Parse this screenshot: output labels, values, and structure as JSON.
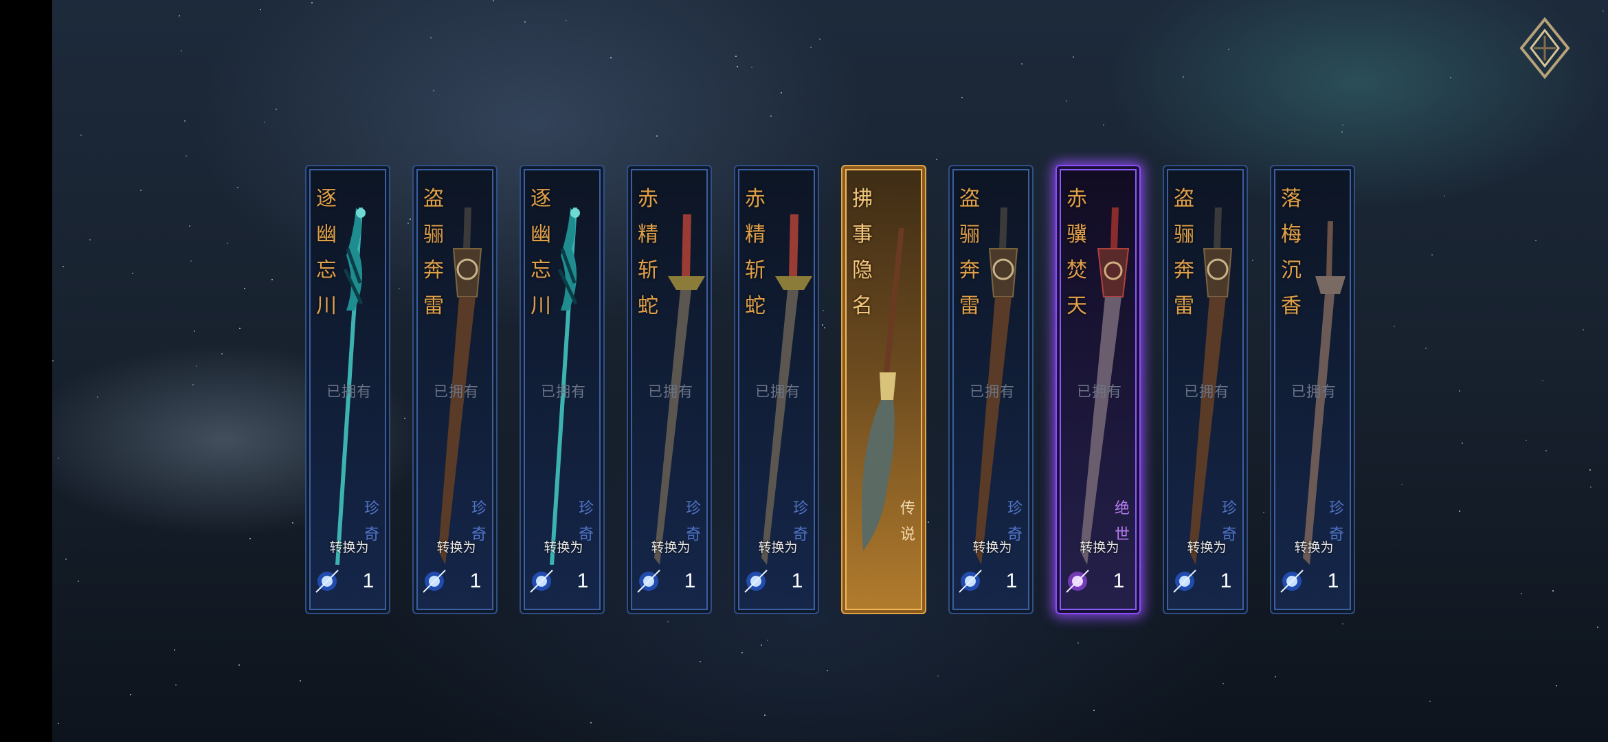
{
  "labels": {
    "owned": "已拥有",
    "convert": "转换为"
  },
  "icons": {
    "return": "return-diamond-icon",
    "currency": "spirit-crystal-icon"
  },
  "rarity_colors": {
    "奇珍": "#3b5fa0",
    "传说": "#f0b85a",
    "绝世": "#8a5cff"
  },
  "cards": [
    {
      "name": "逐幽忘川",
      "rarity": "珍奇",
      "cost": "1",
      "weapon": "jade-spear"
    },
    {
      "name": "盗骊奔雷",
      "rarity": "珍奇",
      "cost": "1",
      "weapon": "bronze-sword"
    },
    {
      "name": "逐幽忘川",
      "rarity": "珍奇",
      "cost": "1",
      "weapon": "jade-spear"
    },
    {
      "name": "赤精斩蛇",
      "rarity": "珍奇",
      "cost": "1",
      "weapon": "red-hilt-sword"
    },
    {
      "name": "赤精斩蛇",
      "rarity": "珍奇",
      "cost": "1",
      "weapon": "red-hilt-sword"
    },
    {
      "name": "拂事隐名",
      "rarity": "传说",
      "cost": "",
      "weapon": "horsetail-whisk"
    },
    {
      "name": "盗骊奔雷",
      "rarity": "珍奇",
      "cost": "1",
      "weapon": "bronze-sword"
    },
    {
      "name": "赤骥焚天",
      "rarity": "绝世",
      "cost": "1",
      "weapon": "crimson-sword"
    },
    {
      "name": "盗骊奔雷",
      "rarity": "珍奇",
      "cost": "1",
      "weapon": "bronze-sword"
    },
    {
      "name": "落梅沉香",
      "rarity": "珍奇",
      "cost": "1",
      "weapon": "wooden-sword"
    }
  ]
}
